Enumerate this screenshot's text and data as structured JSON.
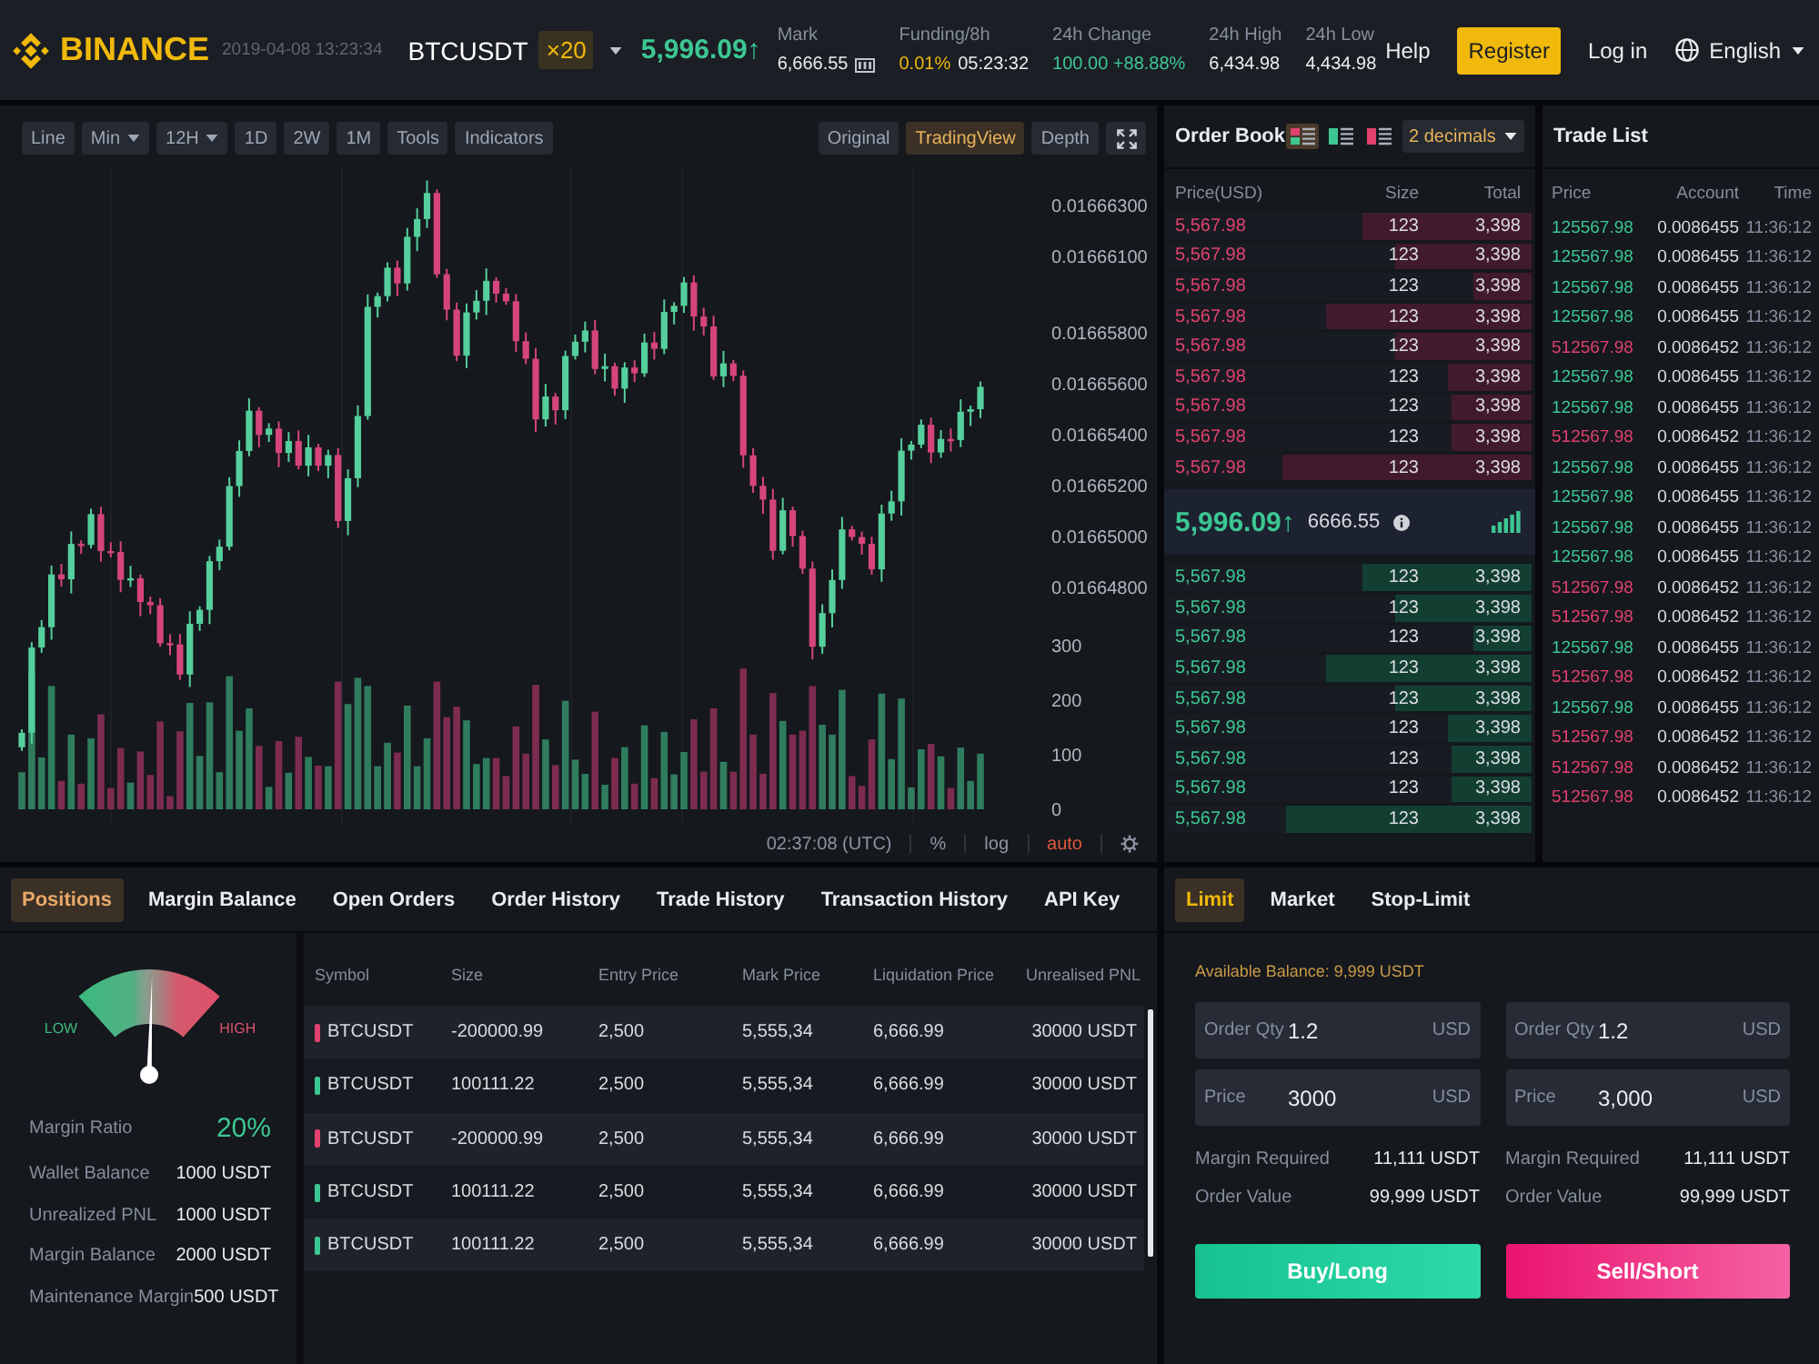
{
  "header": {
    "logo": "BINANCE",
    "datetime": "2019-04-08 13:23:34",
    "symbol": "BTCUSDT",
    "leverage": "×20",
    "last_price": "5,996.09↑",
    "stats": [
      {
        "kind": "mark",
        "label": "Mark",
        "value": "6,666.55"
      },
      {
        "kind": "funding",
        "label": "Funding/8h",
        "value": "0.01%",
        "countdown": "05:23:32"
      },
      {
        "kind": "change",
        "label": "24h Change",
        "value": "100.00 +88.88%"
      },
      {
        "kind": "plain",
        "label": "24h High",
        "value": "6,434.98"
      },
      {
        "kind": "plain",
        "label": "24h Low",
        "value": "4,434.98"
      }
    ],
    "nav": {
      "help": "Help",
      "register": "Register",
      "login": "Log in",
      "language": "English"
    }
  },
  "chart": {
    "intervals": [
      {
        "label": "Line",
        "dropdown": false
      },
      {
        "label": "Min",
        "dropdown": true
      },
      {
        "label": "12H",
        "dropdown": true
      },
      {
        "label": "1D",
        "dropdown": false
      },
      {
        "label": "2W",
        "dropdown": false
      },
      {
        "label": "1M",
        "dropdown": false
      },
      {
        "label": "Tools",
        "dropdown": false
      },
      {
        "label": "Indicators",
        "dropdown": false
      }
    ],
    "views": [
      {
        "label": "Original",
        "selected": false
      },
      {
        "label": "TradingView",
        "selected": true
      },
      {
        "label": "Depth",
        "selected": false
      }
    ],
    "candles": {
      "chart_data": {
        "type": "candlestick",
        "categories": [
          null,
          null,
          null,
          null,
          null,
          null,
          null,
          null,
          null,
          null,
          null,
          null,
          null,
          null,
          null,
          null,
          null,
          null,
          null,
          null,
          null,
          null,
          null,
          null,
          null,
          null,
          null,
          null,
          null,
          null,
          null,
          null,
          null,
          null,
          null,
          null,
          null,
          null,
          null,
          null,
          null,
          null,
          null,
          null,
          null,
          null,
          null,
          null,
          null,
          null,
          null,
          null,
          null,
          null,
          null,
          null,
          null,
          null,
          null,
          null,
          null,
          null,
          null,
          null,
          null,
          null,
          null,
          null,
          null,
          null,
          null,
          null,
          null,
          null,
          null,
          null,
          null,
          null,
          null,
          null,
          null,
          null,
          null,
          null,
          null,
          null,
          null,
          null,
          null,
          null,
          null,
          null,
          null,
          null,
          null,
          null,
          null,
          null
        ],
        "ohlc": [
          [
            0.01664172,
            0.01664243,
            0.01664158,
            0.01664229
          ],
          [
            0.01664229,
            0.01664585,
            0.01664187,
            0.01664564
          ],
          [
            0.01664564,
            0.01664672,
            0.01664543,
            0.01664644
          ],
          [
            0.01664644,
            0.01664886,
            0.01664595,
            0.01664851
          ],
          [
            0.01664851,
            0.01664893,
            0.01664804,
            0.01664832
          ],
          [
            0.01664832,
            0.0166502,
            0.01664776,
            0.01664971
          ],
          [
            0.01664971,
            0.01664985,
            0.01664932,
            0.01664967
          ],
          [
            0.01664967,
            0.01665109,
            0.01664953,
            0.01665088
          ],
          [
            0.01665088,
            0.01665116,
            0.01664901,
            0.01664943
          ],
          [
            0.01664943,
            0.01664978,
            0.01664918,
            0.01664939
          ],
          [
            0.01664939,
            0.01664981,
            0.01664781,
            0.0166483
          ],
          [
            0.0166483,
            0.01664885,
            0.01664802,
            0.01664836
          ],
          [
            0.01664836,
            0.0166485,
            0.01664687,
            0.01664743
          ],
          [
            0.01664743,
            0.01664764,
            0.01664695,
            0.0166473
          ],
          [
            0.0166473,
            0.01664758,
            0.01664567,
            0.01664581
          ],
          [
            0.01664581,
            0.01664616,
            0.01664534,
            0.01664576
          ],
          [
            0.01664576,
            0.01664618,
            0.01664437,
            0.01664458
          ],
          [
            0.01664458,
            0.01664706,
            0.01664409,
            0.01664657
          ],
          [
            0.01664657,
            0.01664726,
            0.01664629,
            0.01664712
          ],
          [
            0.01664712,
            0.01664924,
            0.01664656,
            0.01664903
          ],
          [
            0.01664903,
            0.01664988,
            0.01664868,
            0.0166496
          ],
          [
            0.0166496,
            0.01665233,
            0.01664946,
            0.01665198
          ],
          [
            0.01665198,
            0.01665378,
            0.01665156,
            0.01665336
          ],
          [
            0.01665336,
            0.01665543,
            0.01665315,
            0.01665494
          ],
          [
            0.01665494,
            0.01665508,
            0.0166535,
            0.01665399
          ],
          [
            0.01665399,
            0.01665445,
            0.01665371,
            0.01665424
          ],
          [
            0.01665424,
            0.01665452,
            0.01665272,
            0.01665328
          ],
          [
            0.01665328,
            0.0166541,
            0.01665293,
            0.01665375
          ],
          [
            0.01665375,
            0.01665417,
            0.01665264,
            0.01665278
          ],
          [
            0.01665278,
            0.01665399,
            0.01665236,
            0.0166535
          ],
          [
            0.0166535,
            0.01665364,
            0.01665257,
            0.01665278
          ],
          [
            0.01665278,
            0.01665341,
            0.01665229,
            0.0166532
          ],
          [
            0.0166532,
            0.01665348,
            0.01665033,
            0.01665061
          ],
          [
            0.01665061,
            0.01665264,
            0.01665005,
            0.01665229
          ],
          [
            0.01665229,
            0.01665515,
            0.01665194,
            0.01665473
          ],
          [
            0.01665473,
            0.01665951,
            0.01665459,
            0.01665902
          ],
          [
            0.01665902,
            0.01665958,
            0.0166586,
            0.01665944
          ],
          [
            0.01665944,
            0.01666077,
            0.01665923,
            0.01666056
          ],
          [
            0.01666056,
            0.01666084,
            0.01665945,
            0.01665994
          ],
          [
            0.01665994,
            0.01666212,
            0.01665966,
            0.01666177
          ],
          [
            0.01666177,
            0.01666289,
            0.01666121,
            0.01666247
          ],
          [
            0.01666247,
            0.01666398,
            0.01666212,
            0.01666349
          ],
          [
            0.01666349,
            0.01666363,
            0.01666016,
            0.0166603
          ],
          [
            0.0166603,
            0.01666051,
            0.01665849,
            0.01665891
          ],
          [
            0.01665891,
            0.01665919,
            0.01665689,
            0.0166571
          ],
          [
            0.0166571,
            0.01665915,
            0.01665661,
            0.0166588
          ],
          [
            0.0166588,
            0.01665968,
            0.01665852,
            0.01665926
          ],
          [
            0.01665926,
            0.01666053,
            0.0166587,
            0.01666004
          ],
          [
            0.01666004,
            0.01666018,
            0.01665919,
            0.01665954
          ],
          [
            0.01665954,
            0.01665975,
            0.0166591,
            0.01665924
          ],
          [
            0.01665924,
            0.01665952,
            0.01665725,
            0.01665767
          ],
          [
            0.01665767,
            0.01665802,
            0.01665677,
            0.01665698
          ],
          [
            0.01665698,
            0.0166574,
            0.01665411,
            0.0166546
          ],
          [
            0.0166546,
            0.01665599,
            0.01665432,
            0.0166555
          ],
          [
            0.0166555,
            0.01665564,
            0.0166544,
            0.01665496
          ],
          [
            0.01665496,
            0.0166573,
            0.01665461,
            0.01665709
          ],
          [
            0.01665709,
            0.01665793,
            0.01665695,
            0.01665765
          ],
          [
            0.01665765,
            0.01665844,
            0.01665723,
            0.01665809
          ],
          [
            0.01665809,
            0.01665851,
            0.01665637,
            0.01665658
          ],
          [
            0.01665658,
            0.01665718,
            0.01665609,
            0.01665669
          ],
          [
            0.01665669,
            0.01665683,
            0.01665553,
            0.01665581
          ],
          [
            0.01665581,
            0.01665685,
            0.01665525,
            0.01665664
          ],
          [
            0.01665664,
            0.01665692,
            0.01665606,
            0.01665641
          ],
          [
            0.01665641,
            0.01665797,
            0.01665627,
            0.01665762
          ],
          [
            0.01665762,
            0.01665804,
            0.01665695,
            0.01665737
          ],
          [
            0.01665737,
            0.01665931,
            0.01665716,
            0.01665882
          ],
          [
            0.01665882,
            0.0166592,
            0.01665833,
            0.01665906
          ],
          [
            0.01665906,
            0.01666019,
            0.01665878,
            0.01665998
          ],
          [
            0.01665998,
            0.01666026,
            0.01665808,
            0.01665864
          ],
          [
            0.01665864,
            0.01665899,
            0.0166579,
            0.01665825
          ],
          [
            0.01665825,
            0.01665867,
            0.01665615,
            0.01665629
          ],
          [
            0.01665629,
            0.01665729,
            0.01665587,
            0.0166568
          ],
          [
            0.0166568,
            0.01665694,
            0.0166561,
            0.01665631
          ],
          [
            0.01665631,
            0.01665652,
            0.0166527,
            0.01665319
          ],
          [
            0.01665319,
            0.01665347,
            0.01665171,
            0.01665199
          ],
          [
            0.01665199,
            0.01665234,
            0.01665089,
            0.01665145
          ],
          [
            0.01665145,
            0.01665187,
            0.01664909,
            0.01664944
          ],
          [
            0.01664944,
            0.01665152,
            0.0166493,
            0.01665103
          ],
          [
            0.01665103,
            0.01665117,
            0.0166496,
            0.01665002
          ],
          [
            0.01665002,
            0.01665023,
            0.01664853,
            0.01664874
          ],
          [
            0.01664874,
            0.01664902,
            0.01664518,
            0.01664567
          ],
          [
            0.01664567,
            0.01664734,
            0.01664539,
            0.01664699
          ],
          [
            0.01664699,
            0.01664871,
            0.01664643,
            0.01664829
          ],
          [
            0.01664829,
            0.01665077,
            0.01664794,
            0.01665028
          ],
          [
            0.01665028,
            0.01665042,
            0.01664984,
            0.01664998
          ],
          [
            0.01664998,
            0.01665019,
            0.01664929,
            0.01664971
          ],
          [
            0.01664971,
            0.01664999,
            0.0166485,
            0.01664871
          ],
          [
            0.01664871,
            0.01665125,
            0.01664822,
            0.0166509
          ],
          [
            0.0166509,
            0.0166518,
            0.01665062,
            0.01665138
          ],
          [
            0.01665138,
            0.01665386,
            0.01665082,
            0.01665337
          ],
          [
            0.01665337,
            0.01665375,
            0.01665302,
            0.01665361
          ],
          [
            0.01665361,
            0.0166546,
            0.01665347,
            0.01665439
          ],
          [
            0.01665439,
            0.01665467,
            0.01665288,
            0.0166533
          ],
          [
            0.0166533,
            0.01665418,
            0.01665309,
            0.01665383
          ],
          [
            0.01665383,
            0.01665425,
            0.01665334,
            0.01665379
          ],
          [
            0.01665379,
            0.01665539,
            0.01665351,
            0.0166549
          ],
          [
            0.0166549,
            0.01665514,
            0.01665434,
            0.016655
          ],
          [
            0.016655,
            0.01665609,
            0.01665465,
            0.01665588
          ]
        ],
        "ylim": [
          0.016648,
          0.016663
        ],
        "yticks": [
          {
            "value": 0.016663,
            "label": "0.01666300"
          },
          {
            "value": 0.016661,
            "label": "0.01666100"
          },
          {
            "value": 0.016658,
            "label": "0.01665800"
          },
          {
            "value": 0.016656,
            "label": "0.01665600"
          },
          {
            "value": 0.016654,
            "label": "0.01665400"
          },
          {
            "value": 0.016652,
            "label": "0.01665200"
          },
          {
            "value": 0.01665,
            "label": "0.01665000"
          },
          {
            "value": 0.016648,
            "label": "0.01664800"
          }
        ]
      }
    },
    "volume": {
      "chart_data": {
        "type": "bar",
        "categories": [
          null,
          null,
          null,
          null,
          null,
          null,
          null,
          null,
          null,
          null,
          null,
          null,
          null,
          null,
          null,
          null,
          null,
          null,
          null,
          null,
          null,
          null,
          null,
          null,
          null,
          null,
          null,
          null,
          null,
          null,
          null,
          null,
          null,
          null,
          null,
          null,
          null,
          null,
          null,
          null,
          null,
          null,
          null,
          null,
          null,
          null,
          null,
          null,
          null,
          null,
          null,
          null,
          null,
          null,
          null,
          null,
          null,
          null,
          null,
          null,
          null,
          null,
          null,
          null,
          null,
          null,
          null,
          null,
          null,
          null,
          null,
          null,
          null,
          null,
          null,
          null,
          null,
          null,
          null,
          null,
          null,
          null,
          null,
          null,
          null,
          null,
          null,
          null,
          null,
          null,
          null,
          null,
          null,
          null,
          null,
          null,
          null,
          null
        ],
        "values": [
          68,
          250,
          95,
          226,
          52,
          137,
          47,
          130,
          174,
          39,
          112,
          49,
          106,
          63,
          161,
          24,
          143,
          195,
          98,
          196,
          68,
          244,
          144,
          185,
          116,
          41,
          125,
          67,
          133,
          96,
          80,
          79,
          234,
          193,
          241,
          226,
          79,
          122,
          104,
          190,
          79,
          130,
          234,
          169,
          188,
          163,
          83,
          94,
          94,
          61,
          152,
          102,
          228,
          128,
          81,
          199,
          91,
          65,
          179,
          45,
          94,
          114,
          47,
          154,
          57,
          142,
          64,
          105,
          165,
          69,
          185,
          87,
          69,
          258,
          137,
          65,
          213,
          162,
          137,
          144,
          226,
          155,
          137,
          219,
          61,
          43,
          128,
          212,
          92,
          203,
          40,
          110,
          120,
          97,
          39,
          113,
          52,
          102
        ],
        "ylim": [
          0,
          300
        ],
        "yticks": [
          {
            "value": 300,
            "label": "300"
          },
          {
            "value": 200,
            "label": "200"
          },
          {
            "value": 100,
            "label": "100"
          },
          {
            "value": 0,
            "label": "0"
          }
        ]
      }
    },
    "footer": {
      "time": "02:37:08 (UTC)",
      "percent": "%",
      "log": "log",
      "auto": "auto"
    }
  },
  "order_book": {
    "title": "Order Book",
    "layouts": [
      {
        "kind": "both",
        "selected": true
      },
      {
        "kind": "bids",
        "selected": false
      },
      {
        "kind": "asks",
        "selected": false
      }
    ],
    "precision": "2 decimals",
    "columns": [
      "Price(USD)",
      "Size",
      "Total"
    ],
    "asks": [
      {
        "price": "5,567.98",
        "size": "123",
        "total": "3,398",
        "level": 0.46
      },
      {
        "price": "5,567.98",
        "size": "123",
        "total": "3,398",
        "level": 0.37
      },
      {
        "price": "5,567.98",
        "size": "123",
        "total": "3,398",
        "level": 0.16
      },
      {
        "price": "5,567.98",
        "size": "123",
        "total": "3,398",
        "level": 0.56
      },
      {
        "price": "5,567.98",
        "size": "123",
        "total": "3,398",
        "level": 0.37
      },
      {
        "price": "5,567.98",
        "size": "123",
        "total": "3,398",
        "level": 0.23
      },
      {
        "price": "5,567.98",
        "size": "123",
        "total": "3,398",
        "level": 0.22
      },
      {
        "price": "5,567.98",
        "size": "123",
        "total": "3,398",
        "level": 0.22
      },
      {
        "price": "5,567.98",
        "size": "123",
        "total": "3,398",
        "level": 0.68
      }
    ],
    "last_price": "5,996.09↑",
    "mark_price": "6666.55",
    "bids": [
      {
        "price": "5,567.98",
        "size": "123",
        "total": "3,398",
        "level": 0.46
      },
      {
        "price": "5,567.98",
        "size": "123",
        "total": "3,398",
        "level": 0.37
      },
      {
        "price": "5,567.98",
        "size": "123",
        "total": "3,398",
        "level": 0.16
      },
      {
        "price": "5,567.98",
        "size": "123",
        "total": "3,398",
        "level": 0.56
      },
      {
        "price": "5,567.98",
        "size": "123",
        "total": "3,398",
        "level": 0.37
      },
      {
        "price": "5,567.98",
        "size": "123",
        "total": "3,398",
        "level": 0.23
      },
      {
        "price": "5,567.98",
        "size": "123",
        "total": "3,398",
        "level": 0.22
      },
      {
        "price": "5,567.98",
        "size": "123",
        "total": "3,398",
        "level": 0.22
      },
      {
        "price": "5,567.98",
        "size": "123",
        "total": "3,398",
        "level": 0.67
      }
    ]
  },
  "trade_list": {
    "title": "Trade List",
    "columns": [
      "Price",
      "Account",
      "Time"
    ],
    "rows": [
      {
        "kind": "buy",
        "price": "125567.98",
        "amount": "0.0086455",
        "time": "11:36:12"
      },
      {
        "kind": "buy",
        "price": "125567.98",
        "amount": "0.0086455",
        "time": "11:36:12"
      },
      {
        "kind": "buy",
        "price": "125567.98",
        "amount": "0.0086455",
        "time": "11:36:12"
      },
      {
        "kind": "buy",
        "price": "125567.98",
        "amount": "0.0086455",
        "time": "11:36:12"
      },
      {
        "kind": "sell",
        "price": "512567.98",
        "amount": "0.0086452",
        "time": "11:36:12"
      },
      {
        "kind": "buy",
        "price": "125567.98",
        "amount": "0.0086455",
        "time": "11:36:12"
      },
      {
        "kind": "buy",
        "price": "125567.98",
        "amount": "0.0086455",
        "time": "11:36:12"
      },
      {
        "kind": "sell",
        "price": "512567.98",
        "amount": "0.0086452",
        "time": "11:36:12"
      },
      {
        "kind": "buy",
        "price": "125567.98",
        "amount": "0.0086455",
        "time": "11:36:12"
      },
      {
        "kind": "buy",
        "price": "125567.98",
        "amount": "0.0086455",
        "time": "11:36:12"
      },
      {
        "kind": "buy",
        "price": "125567.98",
        "amount": "0.0086455",
        "time": "11:36:12"
      },
      {
        "kind": "buy",
        "price": "125567.98",
        "amount": "0.0086455",
        "time": "11:36:12"
      },
      {
        "kind": "sell",
        "price": "512567.98",
        "amount": "0.0086452",
        "time": "11:36:12"
      },
      {
        "kind": "sell",
        "price": "512567.98",
        "amount": "0.0086452",
        "time": "11:36:12"
      },
      {
        "kind": "buy",
        "price": "125567.98",
        "amount": "0.0086455",
        "time": "11:36:12"
      },
      {
        "kind": "sell",
        "price": "512567.98",
        "amount": "0.0086452",
        "time": "11:36:12"
      },
      {
        "kind": "buy",
        "price": "125567.98",
        "amount": "0.0086455",
        "time": "11:36:12"
      },
      {
        "kind": "sell",
        "price": "512567.98",
        "amount": "0.0086452",
        "time": "11:36:12"
      },
      {
        "kind": "sell",
        "price": "512567.98",
        "amount": "0.0086452",
        "time": "11:36:12"
      },
      {
        "kind": "sell",
        "price": "512567.98",
        "amount": "0.0086452",
        "time": "11:36:12"
      }
    ]
  },
  "positions": {
    "tabs": [
      {
        "label": "Positions",
        "selected": true
      },
      {
        "label": "Margin Balance",
        "selected": false
      },
      {
        "label": "Open Orders",
        "selected": false
      },
      {
        "label": "Order History",
        "selected": false
      },
      {
        "label": "Trade History",
        "selected": false
      },
      {
        "label": "Transaction History",
        "selected": false
      },
      {
        "label": "API Key",
        "selected": false
      }
    ],
    "gauge": {
      "low": "LOW",
      "high": "HIGH",
      "level": 0.52
    },
    "margin_ratio": {
      "label": "Margin Ratio",
      "value": "20%"
    },
    "balances": [
      {
        "label": "Wallet Balance",
        "value": "1000 USDT"
      },
      {
        "label": "Unrealized PNL",
        "value": "1000 USDT"
      },
      {
        "label": "Margin Balance",
        "value": "2000 USDT"
      },
      {
        "label": "Maintenance Margin",
        "value": "500 USDT"
      }
    ],
    "table": {
      "columns": [
        "Symbol",
        "Size",
        "Entry Price",
        "Mark Price",
        "Liquidation Price",
        "Unrealised PNL"
      ],
      "rows": [
        {
          "kind": "short",
          "symbol": "BTCUSDT",
          "size": "-200000.99",
          "entry_price": "2,500",
          "mark_price": "5,555,34",
          "liquidation_price": "6,666.99",
          "unrealised_pnl": "30000 USDT"
        },
        {
          "kind": "long",
          "symbol": "BTCUSDT",
          "size": "100111.22",
          "entry_price": "2,500",
          "mark_price": "5,555,34",
          "liquidation_price": "6,666.99",
          "unrealised_pnl": "30000 USDT"
        },
        {
          "kind": "short",
          "symbol": "BTCUSDT",
          "size": "-200000.99",
          "entry_price": "2,500",
          "mark_price": "5,555,34",
          "liquidation_price": "6,666.99",
          "unrealised_pnl": "30000 USDT"
        },
        {
          "kind": "long",
          "symbol": "BTCUSDT",
          "size": "100111.22",
          "entry_price": "2,500",
          "mark_price": "5,555,34",
          "liquidation_price": "6,666.99",
          "unrealised_pnl": "30000 USDT"
        },
        {
          "kind": "long",
          "symbol": "BTCUSDT",
          "size": "100111.22",
          "entry_price": "2,500",
          "mark_price": "5,555,34",
          "liquidation_price": "6,666.99",
          "unrealised_pnl": "30000 USDT"
        }
      ]
    }
  },
  "order_form": {
    "tabs": [
      {
        "label": "Limit",
        "selected": true
      },
      {
        "label": "Market",
        "selected": false
      },
      {
        "label": "Stop-Limit",
        "selected": false
      }
    ],
    "available_balance": "Available Balance: 9,999 USDT",
    "sides": [
      {
        "kind": "buy",
        "fields": [
          {
            "label": "Order Qty",
            "value": "1.2",
            "unit": "USD"
          },
          {
            "label": "Price",
            "value": "3000",
            "unit": "USD"
          }
        ],
        "summary": [
          {
            "label": "Margin Required",
            "value": "11,111 USDT"
          },
          {
            "label": "Order Value",
            "value": "99,999 USDT"
          }
        ],
        "action": "Buy/Long"
      },
      {
        "kind": "sell",
        "fields": [
          {
            "label": "Order Qty",
            "value": "1.2",
            "unit": "USD"
          },
          {
            "label": "Price",
            "value": "3,000",
            "unit": "USD"
          }
        ],
        "summary": [
          {
            "label": "Margin Required",
            "value": "11,111 USDT"
          },
          {
            "label": "Order Value",
            "value": "99,999 USDT"
          }
        ],
        "action": "Sell/Short"
      }
    ]
  }
}
